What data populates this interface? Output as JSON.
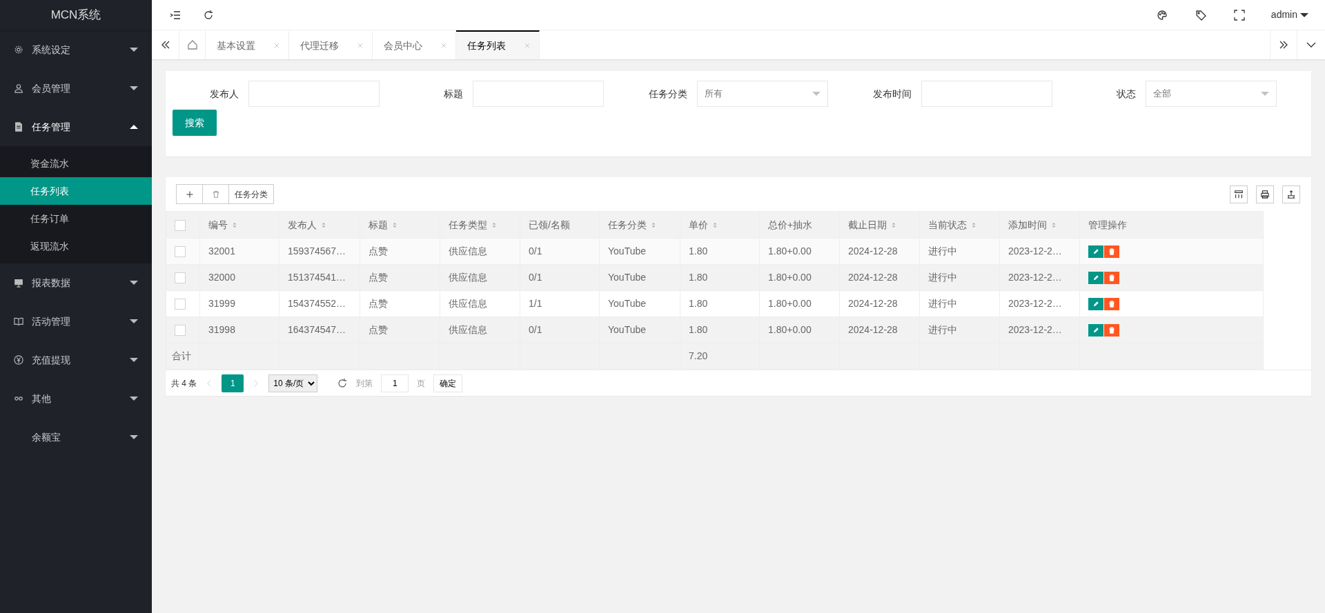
{
  "sidebar": {
    "logo": "MCN系统",
    "items": [
      {
        "label": "系统设定",
        "expanded": false
      },
      {
        "label": "会员管理",
        "expanded": false
      },
      {
        "label": "任务管理",
        "expanded": true,
        "children": [
          {
            "label": "资金流水",
            "selected": false
          },
          {
            "label": "任务列表",
            "selected": true
          },
          {
            "label": "任务订单",
            "selected": false
          },
          {
            "label": "返现流水",
            "selected": false
          }
        ]
      },
      {
        "label": "报表数据",
        "expanded": false
      },
      {
        "label": "活动管理",
        "expanded": false
      },
      {
        "label": "充值提现",
        "expanded": false
      },
      {
        "label": "其他",
        "expanded": false
      },
      {
        "label": "余额宝",
        "expanded": false
      }
    ]
  },
  "header": {
    "user": "admin"
  },
  "tabs": [
    {
      "label": "基本设置",
      "selected": false
    },
    {
      "label": "代理迁移",
      "selected": false
    },
    {
      "label": "会员中心",
      "selected": false
    },
    {
      "label": "任务列表",
      "selected": true
    }
  ],
  "search": {
    "fields": [
      {
        "label": "发布人",
        "kind": "text"
      },
      {
        "label": "标题",
        "kind": "text"
      },
      {
        "label": "任务分类",
        "kind": "select",
        "value": "所有"
      },
      {
        "label": "发布时间",
        "kind": "text"
      },
      {
        "label": "状态",
        "kind": "select",
        "value": "全部"
      }
    ],
    "button": "搜索"
  },
  "toolbar": {
    "category_button": "任务分类"
  },
  "table": {
    "all_checked": false,
    "columns": [
      {
        "label": "编号",
        "sortable": true
      },
      {
        "label": "发布人",
        "sortable": true
      },
      {
        "label": "标题",
        "sortable": true
      },
      {
        "label": "任务类型",
        "sortable": true
      },
      {
        "label": "已领/名额",
        "sortable": false
      },
      {
        "label": "任务分类",
        "sortable": true
      },
      {
        "label": "单价",
        "sortable": true
      },
      {
        "label": "总价+抽水",
        "sortable": false
      },
      {
        "label": "截止日期",
        "sortable": true
      },
      {
        "label": "当前状态",
        "sortable": true
      },
      {
        "label": "添加时间",
        "sortable": true
      },
      {
        "label": "管理操作",
        "sortable": false
      }
    ],
    "rows": [
      {
        "checked": false,
        "cells": [
          "32001",
          "159374567…",
          "点赞",
          "供应信息",
          "0/1",
          "YouTube",
          "1.80",
          "1.80+0.00",
          "2024-12-28",
          "进行中",
          "2023-12-2…"
        ]
      },
      {
        "checked": false,
        "cells": [
          "32000",
          "151374541…",
          "点赞",
          "供应信息",
          "0/1",
          "YouTube",
          "1.80",
          "1.80+0.00",
          "2024-12-28",
          "进行中",
          "2023-12-2…"
        ]
      },
      {
        "checked": false,
        "cells": [
          "31999",
          "154374552…",
          "点赞",
          "供应信息",
          "1/1",
          "YouTube",
          "1.80",
          "1.80+0.00",
          "2024-12-28",
          "进行中",
          "2023-12-2…"
        ]
      },
      {
        "checked": false,
        "cells": [
          "31998",
          "164374547…",
          "点赞",
          "供应信息",
          "0/1",
          "YouTube",
          "1.80",
          "1.80+0.00",
          "2024-12-28",
          "进行中",
          "2023-12-2…"
        ]
      }
    ],
    "total": {
      "label": "合计",
      "value": "7.20"
    }
  },
  "pagination": {
    "count": "共 4 条",
    "current": "1",
    "page_size": "10 条/页",
    "goto_label": "到第",
    "goto_value": "1",
    "page_unit": "页",
    "confirm": "确定"
  }
}
